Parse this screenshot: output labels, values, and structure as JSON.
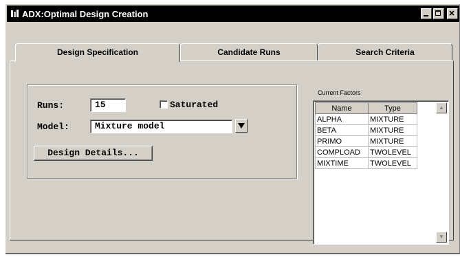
{
  "window": {
    "title": "ADX:Optimal Design Creation"
  },
  "tabs": [
    {
      "label": "Design Specification",
      "active": true
    },
    {
      "label": "Candidate Runs",
      "active": false
    },
    {
      "label": "Search Criteria",
      "active": false
    }
  ],
  "spec": {
    "runs_label": "Runs:",
    "runs_value": "15",
    "saturated_label": "Saturated",
    "saturated_checked": false,
    "model_label": "Model:",
    "model_value": "Mixture model",
    "design_details_label": "Design Details..."
  },
  "factors": {
    "caption": "Current Factors",
    "headers": [
      "Name",
      "Type"
    ],
    "rows": [
      [
        "ALPHA",
        "MIXTURE"
      ],
      [
        "BETA",
        "MIXTURE"
      ],
      [
        "PRIMO",
        "MIXTURE"
      ],
      [
        "COMPLOAD",
        "TWOLEVEL"
      ],
      [
        "MIXTIME",
        "TWOLEVEL"
      ]
    ]
  },
  "icons": {
    "app": "app-icon",
    "minimize": "minimize-icon",
    "maximize": "maximize-icon",
    "close": "close-icon",
    "dropdown": "chevron-down-icon"
  }
}
